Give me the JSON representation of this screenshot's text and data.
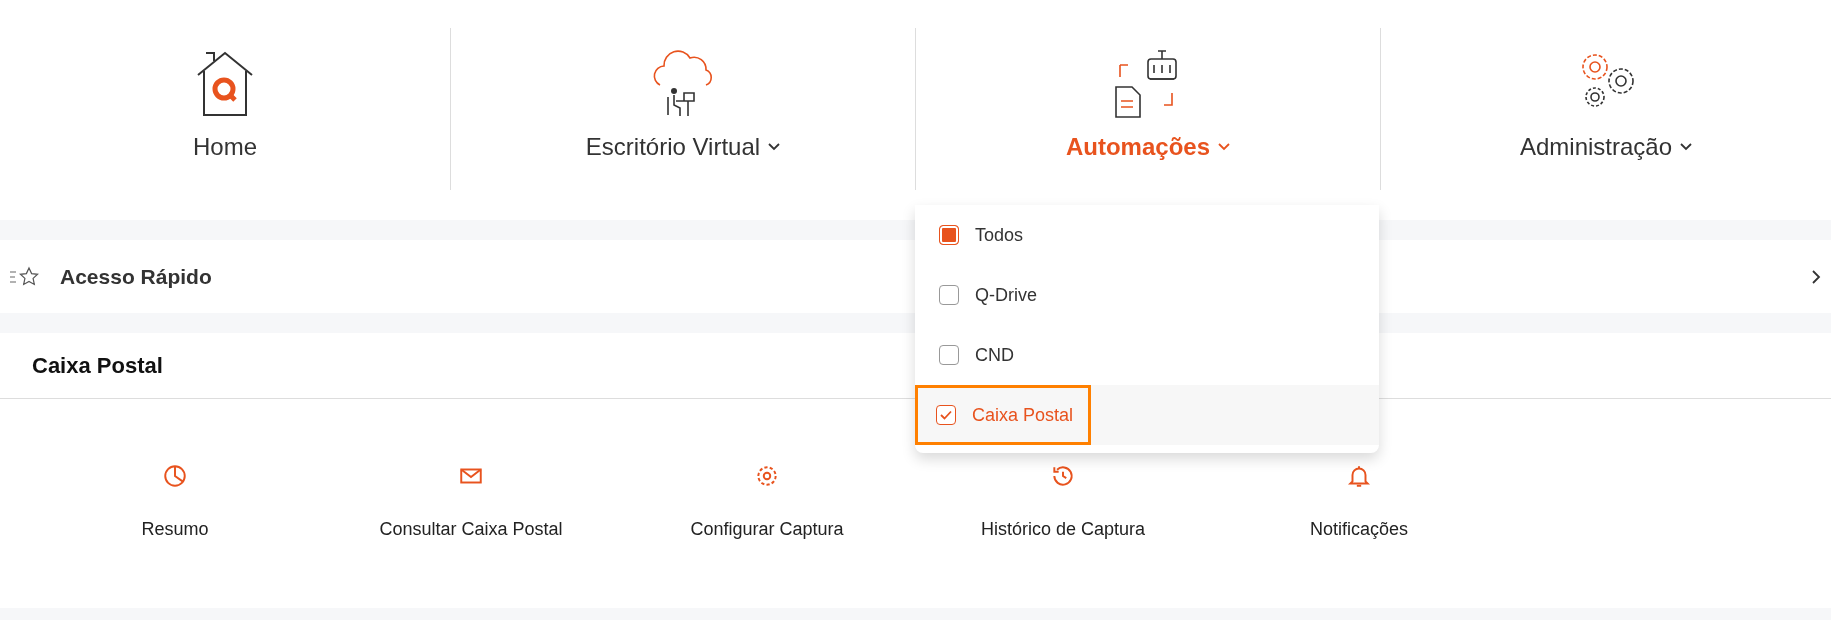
{
  "nav": [
    {
      "kind": "home",
      "label": "Home",
      "has_menu": false,
      "selected": false
    },
    {
      "kind": "cloud",
      "label": "Escritório Virtual",
      "has_menu": true,
      "selected": false
    },
    {
      "kind": "robot",
      "label": "Automações",
      "has_menu": true,
      "selected": true
    },
    {
      "kind": "gears",
      "label": "Administração",
      "has_menu": true,
      "selected": false
    }
  ],
  "dropdown": {
    "items": [
      {
        "label": "Todos",
        "kind": "all",
        "checked": true,
        "selected": false,
        "outlined": false
      },
      {
        "label": "Q-Drive",
        "kind": "item",
        "checked": false,
        "selected": false,
        "outlined": false
      },
      {
        "label": "CND",
        "kind": "item",
        "checked": false,
        "selected": false,
        "outlined": false
      },
      {
        "label": "Caixa Postal",
        "kind": "item",
        "checked": true,
        "selected": true,
        "outlined": true
      }
    ]
  },
  "quick_access": {
    "label": "Acesso Rápido"
  },
  "section": {
    "title": "Caixa Postal",
    "tiles": [
      {
        "kind": "pie",
        "label": "Resumo"
      },
      {
        "kind": "mail",
        "label": "Consultar Caixa Postal"
      },
      {
        "kind": "gear",
        "label": "Configurar Captura"
      },
      {
        "kind": "history",
        "label": "Histórico de Captura"
      },
      {
        "kind": "bell",
        "label": "Notificações"
      }
    ]
  }
}
